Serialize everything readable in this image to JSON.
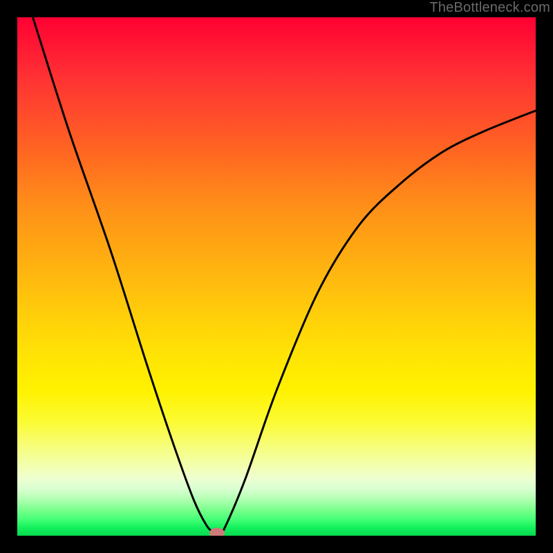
{
  "watermark": "TheBottleneck.com",
  "chart_data": {
    "type": "line",
    "title": "",
    "xlabel": "",
    "ylabel": "",
    "xlim": [
      0,
      100
    ],
    "ylim": [
      0,
      100
    ],
    "grid": false,
    "legend": false,
    "annotations": [
      "bottleneck curve with optimum marker"
    ],
    "series": [
      {
        "name": "bottleneck-curve",
        "color": "#000000",
        "x": [
          3,
          10,
          18,
          25,
          30,
          34,
          36.5,
          38,
          39,
          40,
          44,
          50,
          58,
          66,
          74,
          82,
          90,
          100
        ],
        "y": [
          100,
          78,
          55,
          33,
          18,
          7,
          2,
          0.6,
          0.5,
          1.5,
          11,
          28,
          47,
          60,
          68,
          74,
          78,
          82
        ]
      }
    ],
    "optimum_marker": {
      "x": 38.5,
      "y": 0.5,
      "color": "#cc7b78"
    },
    "background_gradient": {
      "top": "#ff0033",
      "mid": "#fff200",
      "bottom": "#08d84e"
    }
  }
}
